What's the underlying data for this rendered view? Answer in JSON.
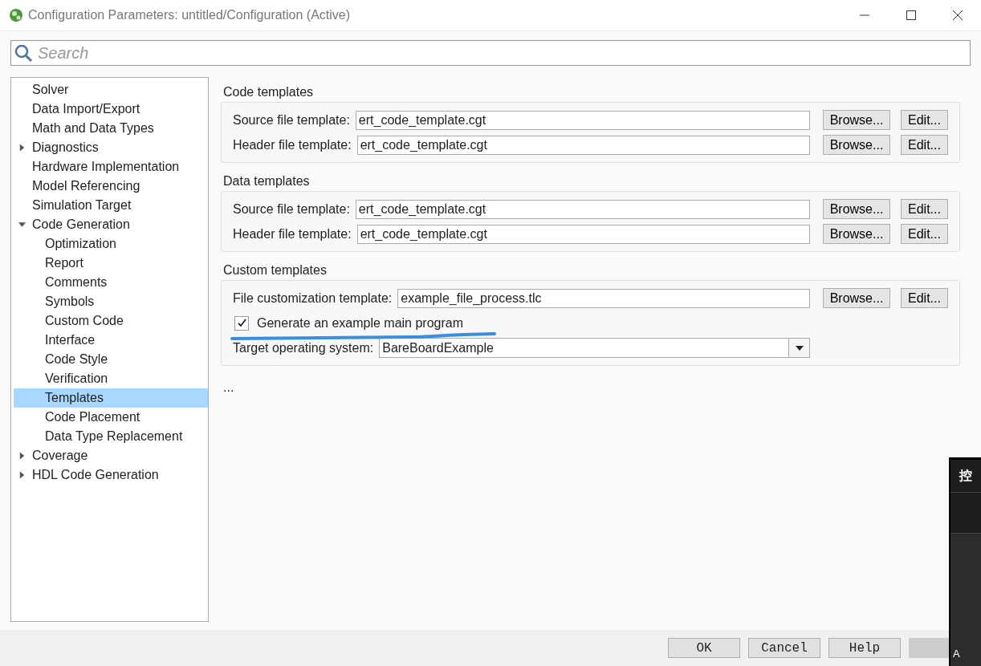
{
  "window": {
    "title": "Configuration Parameters: untitled/Configuration (Active)"
  },
  "search": {
    "placeholder": "Search"
  },
  "tree": [
    {
      "label": "Solver",
      "selected": false
    },
    {
      "label": "Data Import/Export",
      "selected": false
    },
    {
      "label": "Math and Data Types",
      "selected": false
    },
    {
      "label": "Diagnostics",
      "selected": false,
      "expanded": false
    },
    {
      "label": "Hardware Implementation",
      "selected": false
    },
    {
      "label": "Model Referencing",
      "selected": false
    },
    {
      "label": "Simulation Target",
      "selected": false
    },
    {
      "label": "Code Generation",
      "selected": false,
      "expanded": true,
      "children": [
        {
          "label": "Optimization",
          "selected": false
        },
        {
          "label": "Report",
          "selected": false
        },
        {
          "label": "Comments",
          "selected": false
        },
        {
          "label": "Symbols",
          "selected": false
        },
        {
          "label": "Custom Code",
          "selected": false
        },
        {
          "label": "Interface",
          "selected": false
        },
        {
          "label": "Code Style",
          "selected": false
        },
        {
          "label": "Verification",
          "selected": false
        },
        {
          "label": "Templates",
          "selected": true
        },
        {
          "label": "Code Placement",
          "selected": false
        },
        {
          "label": "Data Type Replacement",
          "selected": false
        }
      ]
    },
    {
      "label": "Coverage",
      "selected": false,
      "expanded": false
    },
    {
      "label": "HDL Code Generation",
      "selected": false,
      "expanded": false
    }
  ],
  "groups": [
    {
      "title": "Code templates",
      "rows": [
        {
          "kind": "file",
          "label": "Source file template:",
          "value": "ert_code_template.cgt",
          "browse": "Browse...",
          "edit": "Edit..."
        },
        {
          "kind": "file",
          "label": "Header file template:",
          "value": "ert_code_template.cgt",
          "browse": "Browse...",
          "edit": "Edit..."
        }
      ]
    },
    {
      "title": "Data templates",
      "rows": [
        {
          "kind": "file",
          "label": "Source file template:",
          "value": "ert_code_template.cgt",
          "browse": "Browse...",
          "edit": "Edit..."
        },
        {
          "kind": "file",
          "label": "Header file template:",
          "value": "ert_code_template.cgt",
          "browse": "Browse...",
          "edit": "Edit..."
        }
      ]
    },
    {
      "title": "Custom templates",
      "rows": [
        {
          "kind": "file",
          "label": "File customization template:",
          "value": "example_file_process.tlc",
          "browse": "Browse...",
          "edit": "Edit..."
        },
        {
          "kind": "checkbox",
          "label": "Generate an example main program",
          "checked": true
        },
        {
          "kind": "dropdown",
          "label": "Target operating system:",
          "value": "BareBoardExample"
        }
      ]
    }
  ],
  "more": "...",
  "buttons": [
    {
      "label": "OK",
      "disabled": false
    },
    {
      "label": "Cancel",
      "disabled": false
    },
    {
      "label": "Help",
      "disabled": false
    },
    {
      "disabled": true
    }
  ],
  "side_window": {
    "title": "控",
    "line": "A"
  }
}
